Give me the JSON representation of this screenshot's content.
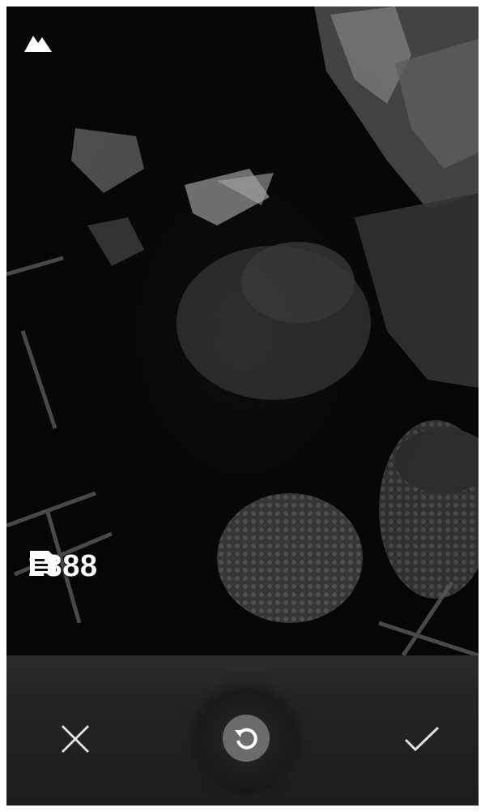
{
  "viewfinder": {
    "scene_mode_icon": "mountain-icon"
  },
  "storage": {
    "icon": "sd-card-icon",
    "remaining_count": "1388"
  },
  "controls": {
    "cancel_icon": "close-icon",
    "retake_icon": "rotate-icon",
    "confirm_icon": "check-icon"
  },
  "colors": {
    "overlay_text": "#ffffff",
    "controls_bg": "#242424",
    "retake_button": "#6b6b6b"
  }
}
